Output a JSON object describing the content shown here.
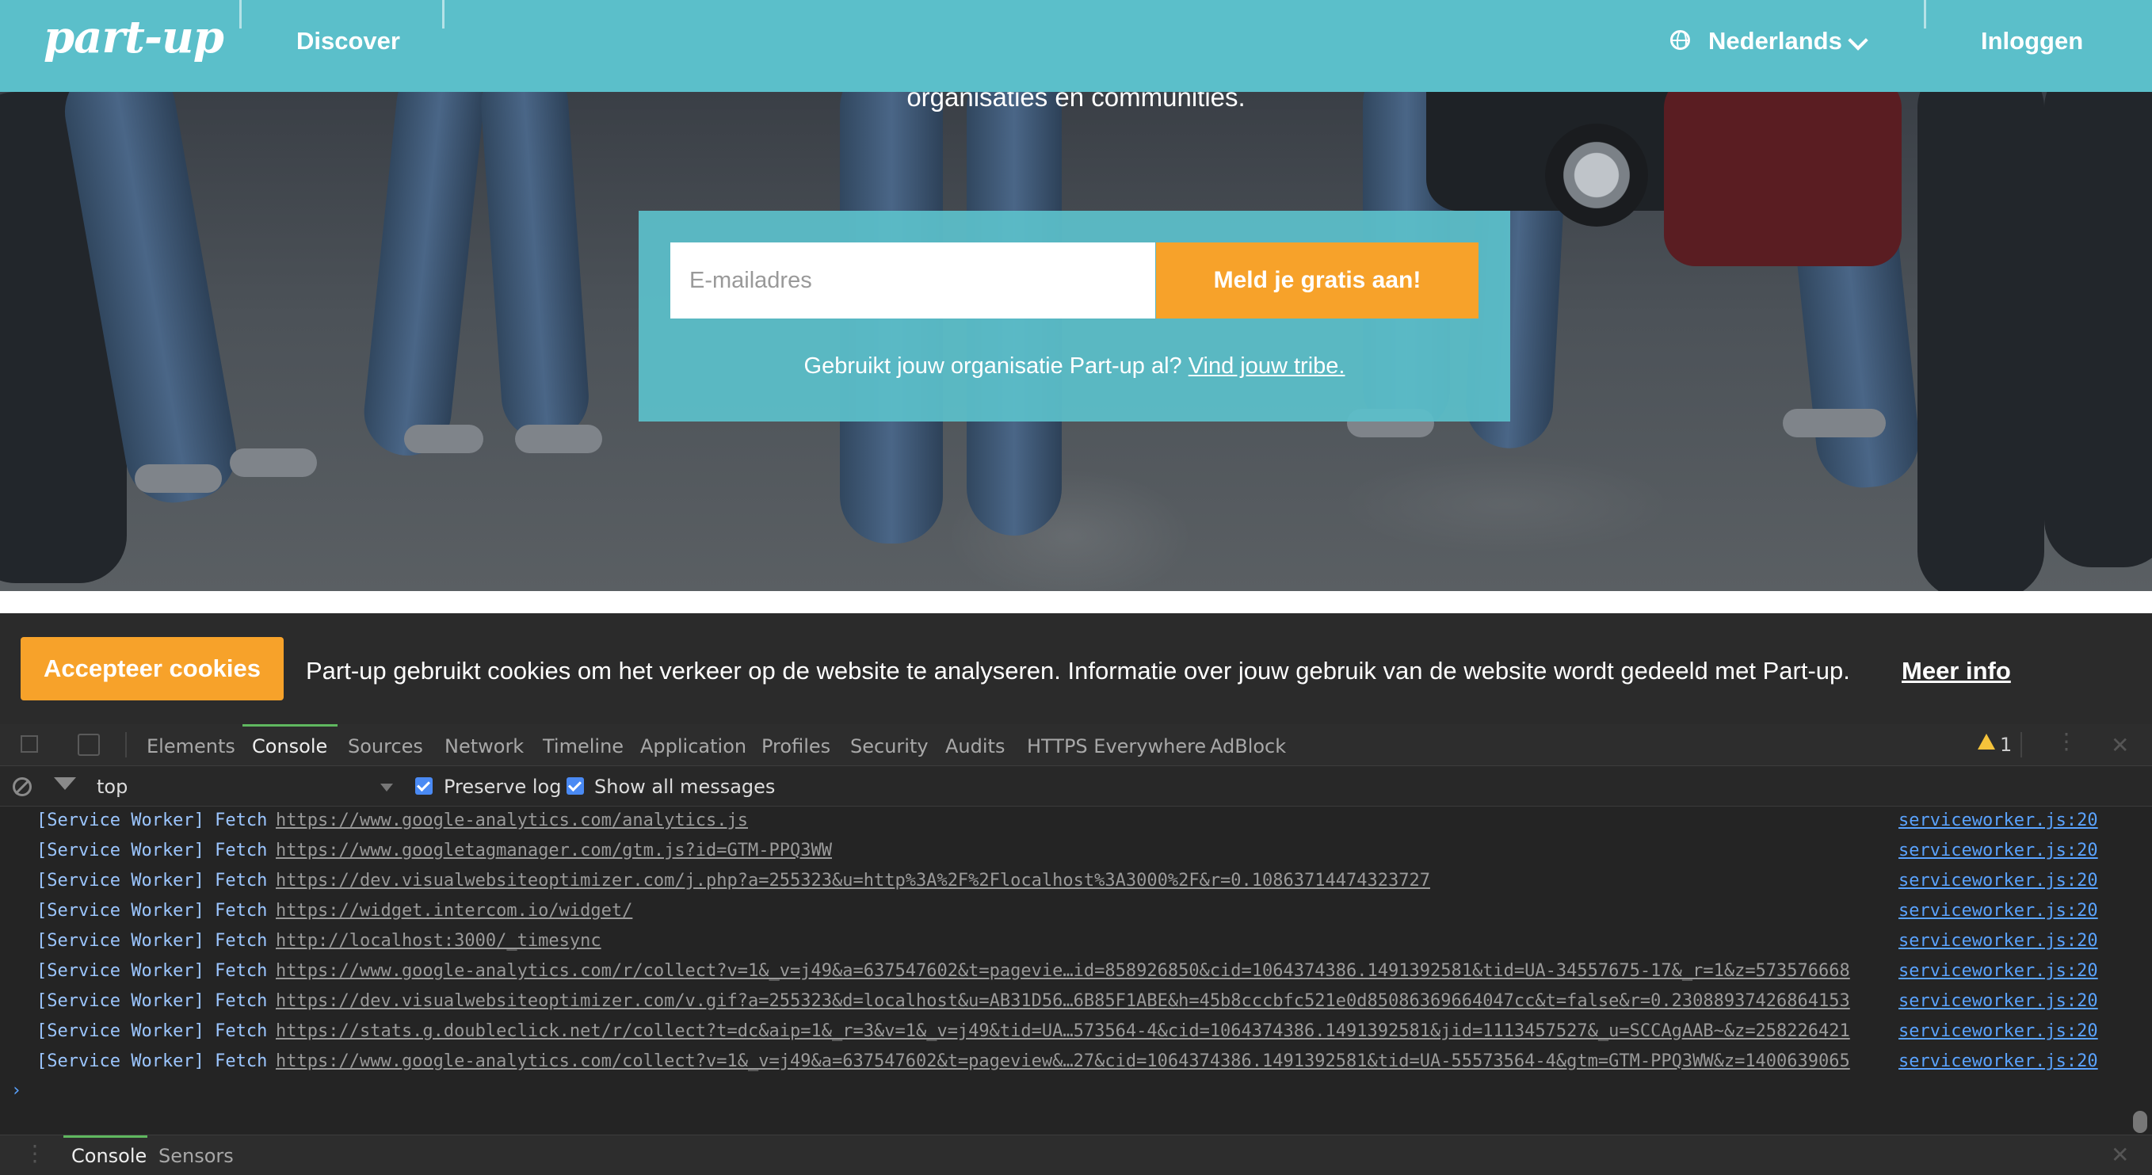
{
  "nav": {
    "logo": "part-up",
    "discover": "Discover",
    "language": "Nederlands",
    "login": "Inloggen"
  },
  "hero": {
    "tagline_partial": "organisaties en communities.",
    "email_placeholder": "E-mailadres",
    "signup_button": "Meld je gratis aan!",
    "tribe_question": "Gebruikt jouw organisatie Part-up al?",
    "tribe_link": "Vind jouw tribe."
  },
  "cookie": {
    "accept_button": "Accepteer cookies",
    "message": "Part-up gebruikt cookies om het verkeer op de website te analyseren. Informatie over jouw gebruik van de website wordt gedeeld met Part-up.",
    "more_info": "Meer info"
  },
  "devtools": {
    "tabs": [
      "Elements",
      "Console",
      "Sources",
      "Network",
      "Timeline",
      "Application",
      "Profiles",
      "Security",
      "Audits",
      "HTTPS Everywhere",
      "AdBlock"
    ],
    "active_tab": "Console",
    "warning_count": "1",
    "context": "top",
    "preserve_log": "Preserve log",
    "show_all": "Show all messages",
    "log_prefix": "[Service Worker] Fetch",
    "logs": [
      {
        "url": "https://www.google-analytics.com/analytics.js",
        "source": "serviceworker.js:20"
      },
      {
        "url": "https://www.googletagmanager.com/gtm.js?id=GTM-PPQ3WW",
        "source": "serviceworker.js:20"
      },
      {
        "url": "https://dev.visualwebsiteoptimizer.com/j.php?a=255323&u=http%3A%2F%2Flocalhost%3A3000%2F&r=0.10863714474323727",
        "source": "serviceworker.js:20"
      },
      {
        "url": "https://widget.intercom.io/widget/",
        "source": "serviceworker.js:20"
      },
      {
        "url": "http://localhost:3000/_timesync",
        "source": "serviceworker.js:20"
      },
      {
        "url": "https://www.google-analytics.com/r/collect?v=1&_v=j49&a=637547602&t=pagevie…id=858926850&cid=1064374386.1491392581&tid=UA-34557675-17&_r=1&z=573576668",
        "source": "serviceworker.js:20"
      },
      {
        "url": "https://dev.visualwebsiteoptimizer.com/v.gif?a=255323&d=localhost&u=AB31D56…6B85F1ABE&h=45b8cccbfc521e0d85086369664047cc&t=false&r=0.23088937426864153",
        "source": "serviceworker.js:20"
      },
      {
        "url": "https://stats.g.doubleclick.net/r/collect?t=dc&aip=1&_r=3&v=1&_v=j49&tid=UA…573564-4&cid=1064374386.1491392581&jid=1113457527&_u=SCCAgAAB~&z=258226421",
        "source": "serviceworker.js:20"
      },
      {
        "url": "https://www.google-analytics.com/collect?v=1&_v=j49&a=637547602&t=pageview&…27&cid=1064374386.1491392581&tid=UA-55573564-4&gtm=GTM-PPQ3WW&z=1400639065",
        "source": "serviceworker.js:20"
      }
    ],
    "prompt": "›",
    "drawer_tabs": [
      "Console",
      "Sensors"
    ]
  }
}
